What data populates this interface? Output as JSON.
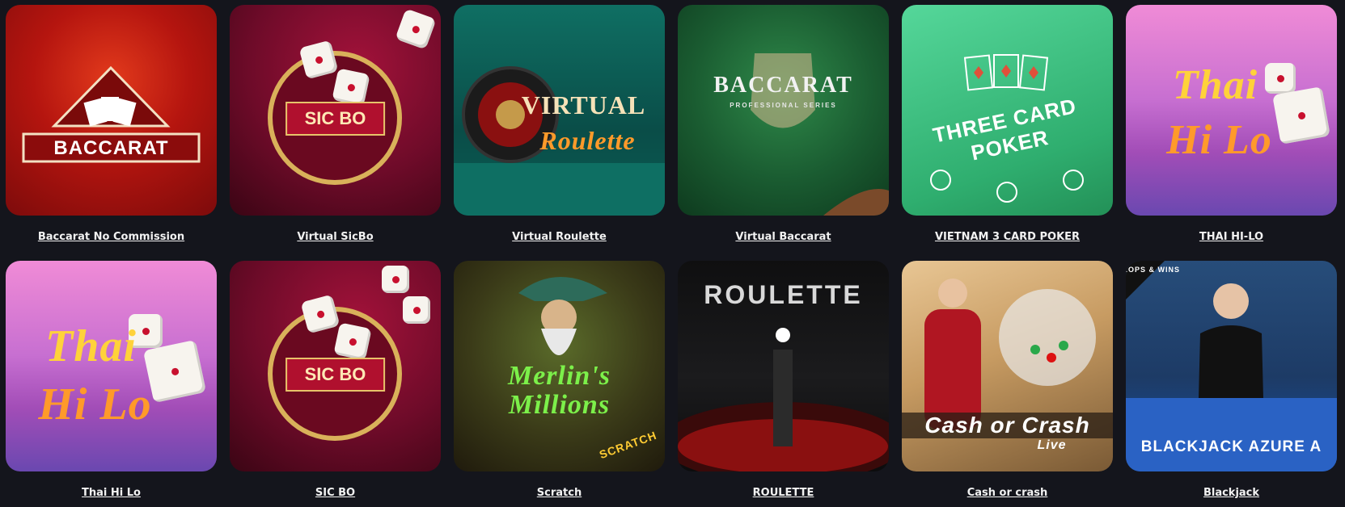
{
  "games": [
    {
      "title": "Baccarat No Commission",
      "art_text": "BACCARAT"
    },
    {
      "title": "Virtual SicBo",
      "art_text": "SIC BO"
    },
    {
      "title": "Virtual Roulette",
      "art_text": "VIRTUAL",
      "art_text2": "Roulette"
    },
    {
      "title": "Virtual Baccarat",
      "art_text": "BACCARAT",
      "art_text2": "PROFESSIONAL SERIES"
    },
    {
      "title": "VIETNAM 3 CARD POKER",
      "art_text": "THREE CARD POKER"
    },
    {
      "title": "THAI HI-LO",
      "art_text": "Thai",
      "art_text2": "Hi Lo"
    },
    {
      "title": "Thai Hi Lo",
      "art_text": "Thai",
      "art_text2": "Hi Lo"
    },
    {
      "title": "SIC BO",
      "art_text": "SIC BO"
    },
    {
      "title": "Scratch",
      "art_text": "Merlin's",
      "art_text2": "Millions",
      "art_text3": "SCRATCH"
    },
    {
      "title": "ROULETTE",
      "art_text": "ROULETTE"
    },
    {
      "title": "Cash or crash",
      "art_text": "Cash or Crash",
      "art_text2": "Live"
    },
    {
      "title": "Blackjack",
      "art_text": "BLACKJACK AZURE A",
      "art_text2": "DROPS & WINS"
    }
  ]
}
